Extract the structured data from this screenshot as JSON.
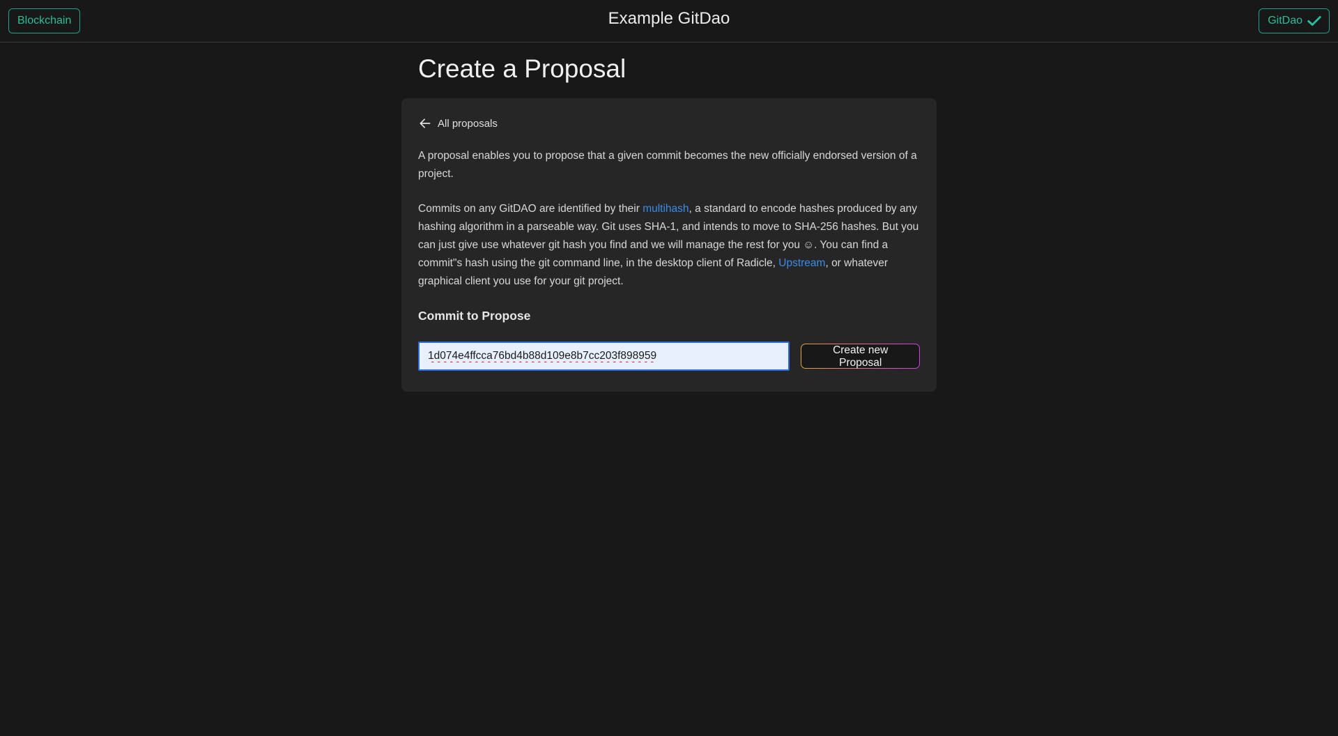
{
  "header": {
    "blockchain_button": "Blockchain",
    "app_title": "Example GitDao",
    "dao_button": "GitDao"
  },
  "page": {
    "title": "Create a Proposal"
  },
  "card": {
    "back_link": "All proposals",
    "paragraph1": "A proposal enables you to propose that a given commit becomes the new officially endorsed version of a project.",
    "paragraph2": {
      "part1": "Commits on any GitDAO are identified by their ",
      "link1": "multihash",
      "part2": ", a standard to encode hashes produced by any hashing algorithm in a parseable way. Git uses SHA-1, and intends to move to SHA-256 hashes. But you can just give use whatever git hash you find and we will manage the rest for you ☺. You can find a commit\"s hash using the git command line, in the desktop client of Radicle, ",
      "link2": "Upstream",
      "part3": ", or whatever graphical client you use for your git project."
    },
    "section_heading": "Commit to Propose",
    "commit_input_value": "1d074e4ffcca76bd4b88d109e8b7cc203f898959",
    "submit_button": "Create new Proposal"
  },
  "icons": {
    "dao_status": "check-icon",
    "back": "arrow-left-icon"
  },
  "colors": {
    "accent": "#1fa383",
    "link": "#3a8ce8",
    "background": "#181818",
    "card": "#262626"
  }
}
